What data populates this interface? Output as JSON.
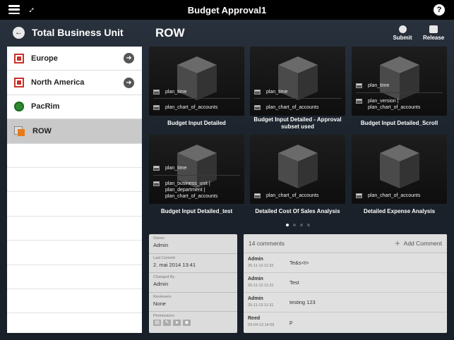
{
  "app": {
    "title": "Budget Approval1",
    "help_label": "?"
  },
  "sidebar": {
    "title": "Total Business Unit",
    "items": [
      {
        "label": "Europe",
        "icon": "red-flag-icon",
        "has_arrow": true
      },
      {
        "label": "North America",
        "icon": "red-flag-icon",
        "has_arrow": true
      },
      {
        "label": "PacRim",
        "icon": "green-circle-icon",
        "has_arrow": false
      },
      {
        "label": "ROW",
        "icon": "member-icon",
        "has_arrow": false,
        "selected": true
      }
    ]
  },
  "page": {
    "title": "ROW"
  },
  "toolbar": {
    "submit_label": "Submit",
    "release_label": "Release"
  },
  "tiles": [
    {
      "title": "Budget Input Detailed",
      "dims": [
        "plan_time",
        "plan_chart_of_accounts"
      ]
    },
    {
      "title": "Budget Input Detailed - Approval subset used",
      "dims": [
        "plan_time",
        "plan_chart_of_accounts"
      ]
    },
    {
      "title": "Budget Input Detailed_Scroll",
      "dims": [
        "plan_time",
        "plan_version | plan_chart_of_accounts"
      ]
    },
    {
      "title": "Budget Input Detailed_test",
      "dims": [
        "plan_time",
        "plan_business_unit | plan_department | plan_chart_of_accounts"
      ]
    },
    {
      "title": "Detailed Cost Of Sales Analysis",
      "dims": [
        "plan_chart_of_accounts"
      ]
    },
    {
      "title": "Detailed Expense Analysis",
      "dims": [
        "plan_chart_of_accounts"
      ]
    }
  ],
  "pager": {
    "pages": 4,
    "current": 1
  },
  "info": {
    "owner_label": "Owner",
    "owner": "Admin",
    "last_commit_label": "Last Commit",
    "last_commit": "2. mai 2014 13:41",
    "changed_by_label": "Changed By",
    "changed_by": "Admin",
    "reviewers_label": "Reviewers",
    "reviewers": "None",
    "permissions_label": "Permissions"
  },
  "comments": {
    "count_label": "14 comments",
    "add_label": "Add Comment",
    "items": [
      {
        "author": "Admin",
        "date": "25-11-13 11:32",
        "text": "Te&s<t>"
      },
      {
        "author": "Admin",
        "date": "25-11-13 11:31",
        "text": "Test"
      },
      {
        "author": "Admin",
        "date": "25-11-13 11:31",
        "text": "testing 123"
      },
      {
        "author": "Reed",
        "date": "03-04-13 14:09",
        "text": "p"
      }
    ]
  }
}
